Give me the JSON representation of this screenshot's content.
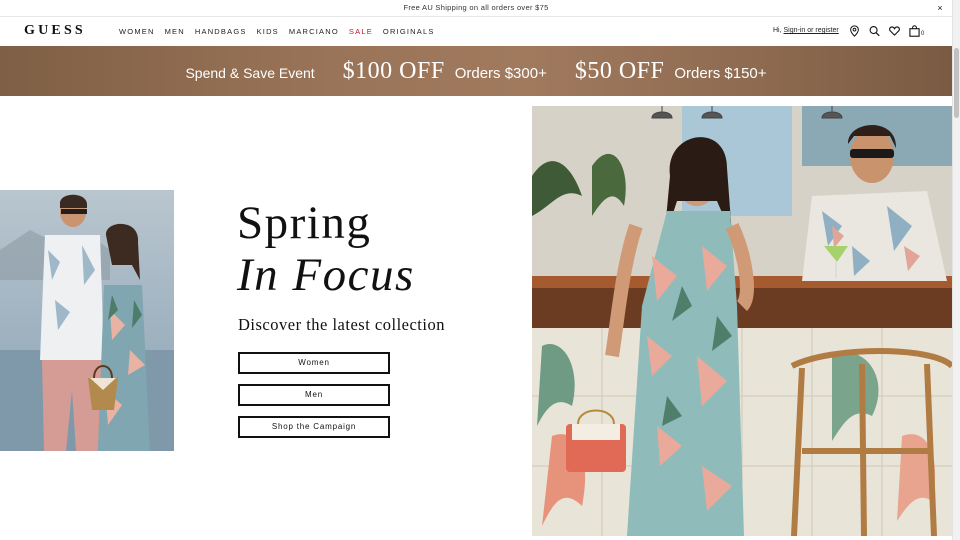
{
  "announcement": {
    "text": "Free AU Shipping on all orders over $75",
    "close": "×"
  },
  "header": {
    "logo": "GUESS",
    "nav": [
      "WOMEN",
      "MEN",
      "HANDBAGS",
      "KIDS",
      "MARCIANO",
      "SALE",
      "ORIGINALS"
    ],
    "greeting": "Hi,",
    "sign_in": "Sign-in or register",
    "bag_count": "0",
    "icons": [
      "location-pin-icon",
      "search-icon",
      "heart-icon",
      "shopping-bag-icon"
    ]
  },
  "promo": {
    "event": "Spend & Save Event",
    "offer1_amount": "$100 OFF",
    "offer1_condition": "Orders $300+",
    "offer2_amount": "$50 OFF",
    "offer2_condition": "Orders $150+"
  },
  "hero": {
    "title_line1": "Spring",
    "title_line2": "In Focus",
    "subtitle": "Discover the latest collection",
    "buttons": [
      "Women",
      "Men",
      "Shop the Campaign"
    ]
  },
  "colors": {
    "sale": "#c8102e",
    "promo_bg": "#9a7458",
    "text": "#111111"
  }
}
